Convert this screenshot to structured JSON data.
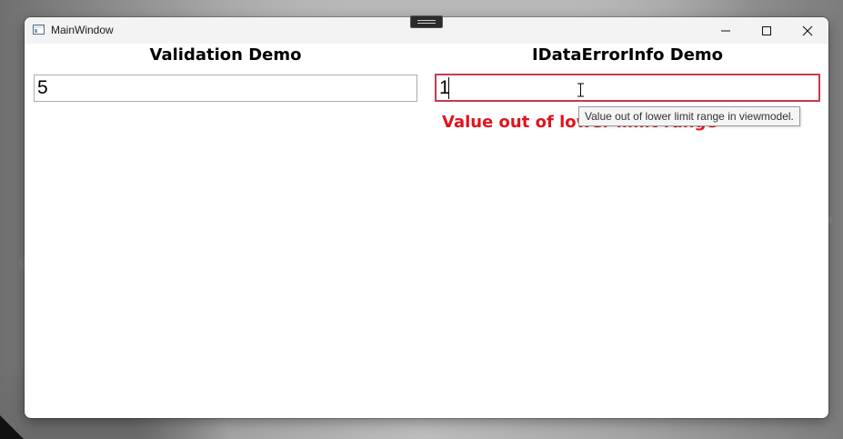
{
  "window": {
    "title": "MainWindow"
  },
  "left_panel": {
    "heading": "Validation Demo",
    "input_value": "5"
  },
  "right_panel": {
    "heading": "IDataErrorInfo Demo",
    "input_value": "1",
    "error_message": "Value out of lower limit range",
    "tooltip": "Value out of lower limit range  in viewmodel."
  },
  "colors": {
    "error": "#e0141e",
    "error_border": "#c83a4e"
  }
}
